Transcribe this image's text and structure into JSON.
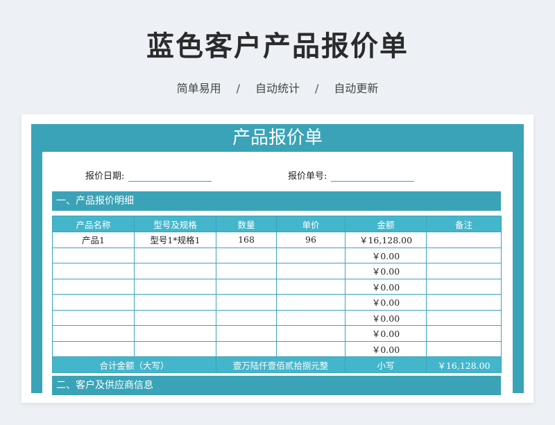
{
  "hero": {
    "title": "蓝色客户产品报价单",
    "features": [
      "简单易用",
      "自动统计",
      "自动更新"
    ],
    "separator": "/"
  },
  "sheet": {
    "title": "产品报价单",
    "quote_date_label": "报价日期:",
    "quote_number_label": "报价单号:",
    "section1_title": "一、产品报价明细",
    "section2_title": "二、客户及供应商信息",
    "columns": [
      "产品名称",
      "型号及规格",
      "数量",
      "单价",
      "金额",
      "备注"
    ],
    "rows": [
      [
        "产品1",
        "型号1*规格1",
        "168",
        "96",
        "￥16,128.00",
        ""
      ],
      [
        "",
        "",
        "",
        "",
        "￥0.00",
        ""
      ],
      [
        "",
        "",
        "",
        "",
        "￥0.00",
        ""
      ],
      [
        "",
        "",
        "",
        "",
        "￥0.00",
        ""
      ],
      [
        "",
        "",
        "",
        "",
        "￥0.00",
        ""
      ],
      [
        "",
        "",
        "",
        "",
        "￥0.00",
        ""
      ],
      [
        "",
        "",
        "",
        "",
        "￥0.00",
        ""
      ],
      [
        "",
        "",
        "",
        "",
        "￥0.00",
        ""
      ]
    ],
    "total": {
      "label": "合计金额（大写）",
      "uppercase_value": "壹万陆仟壹佰贰拾捌元整",
      "small_label": "小写",
      "small_value": "￥16,128.00"
    }
  },
  "colors": {
    "accent": "#3aa3b7",
    "header_fill": "#44b6cc",
    "background": "#edf1f5"
  }
}
